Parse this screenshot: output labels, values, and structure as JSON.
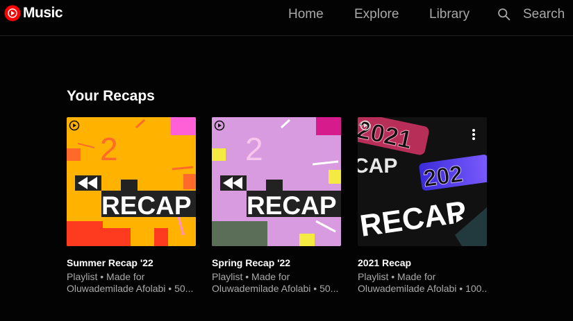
{
  "header": {
    "logo_text": "Music",
    "nav": {
      "home": "Home",
      "explore": "Explore",
      "library": "Library",
      "search": "Search"
    }
  },
  "main": {
    "section_title": "Your Recaps",
    "cards": [
      {
        "title": "Summer Recap '22",
        "subtitle_line1": "Playlist • Made for",
        "subtitle_line2": "Oluwademilade Afolabi • 50...",
        "art_text": "RECAP",
        "art_number": "2"
      },
      {
        "title": "Spring Recap '22",
        "subtitle_line1": "Playlist • Made for",
        "subtitle_line2": "Oluwademilade Afolabi • 50...",
        "art_text": "RECAP",
        "art_number": "2"
      },
      {
        "title": "2021 Recap",
        "subtitle_line1": "Playlist • Made for",
        "subtitle_line2": "Oluwademilade Afolabi • 100...",
        "art_text": "RECAP",
        "art_year": "2021",
        "art_year_short": "202",
        "art_cap": "CAP"
      }
    ]
  },
  "colors": {
    "brand_red": "#ff0000",
    "summer_bg": "#ffb300",
    "spring_bg": "#d99be0",
    "dark_bg": "#111111"
  }
}
